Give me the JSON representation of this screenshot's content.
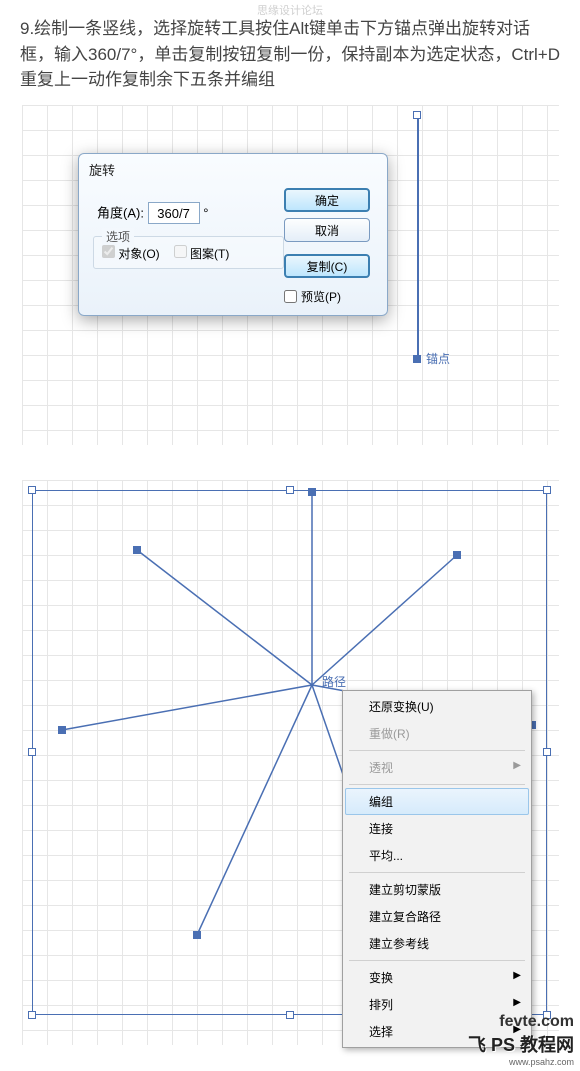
{
  "watermark_top": "思缘设计论坛",
  "instructions": "9.绘制一条竖线，选择旋转工具按住Alt键单击下方锚点弹出旋转对话框，输入360/7°，单击复制按钮复制一份，保持副本为选定状态，Ctrl+D重复上一动作复制余下五条并编组",
  "anchor_label": "锚点",
  "dialog": {
    "title": "旋转",
    "angle_label": "角度(A):",
    "angle_value": "360/7",
    "degree": "°",
    "options_legend": "选项",
    "cb_object": "对象(O)",
    "cb_pattern": "图案(T)",
    "btn_ok": "确定",
    "btn_cancel": "取消",
    "btn_copy": "复制(C)",
    "preview": "预览(P)"
  },
  "path_label": "路径",
  "context_menu": {
    "undo": "还原变换(U)",
    "redo": "重做(R)",
    "perspective": "透视",
    "group": "编组",
    "join": "连接",
    "average": "平均...",
    "clipmask": "建立剪切蒙版",
    "compound": "建立复合路径",
    "guides": "建立参考线",
    "transform": "变换",
    "arrange": "排列",
    "select": "选择"
  },
  "watermark_bottom": {
    "l1": "fevte.com",
    "l2": "飞 PS 教程网",
    "l3": "www.psahz.com"
  }
}
